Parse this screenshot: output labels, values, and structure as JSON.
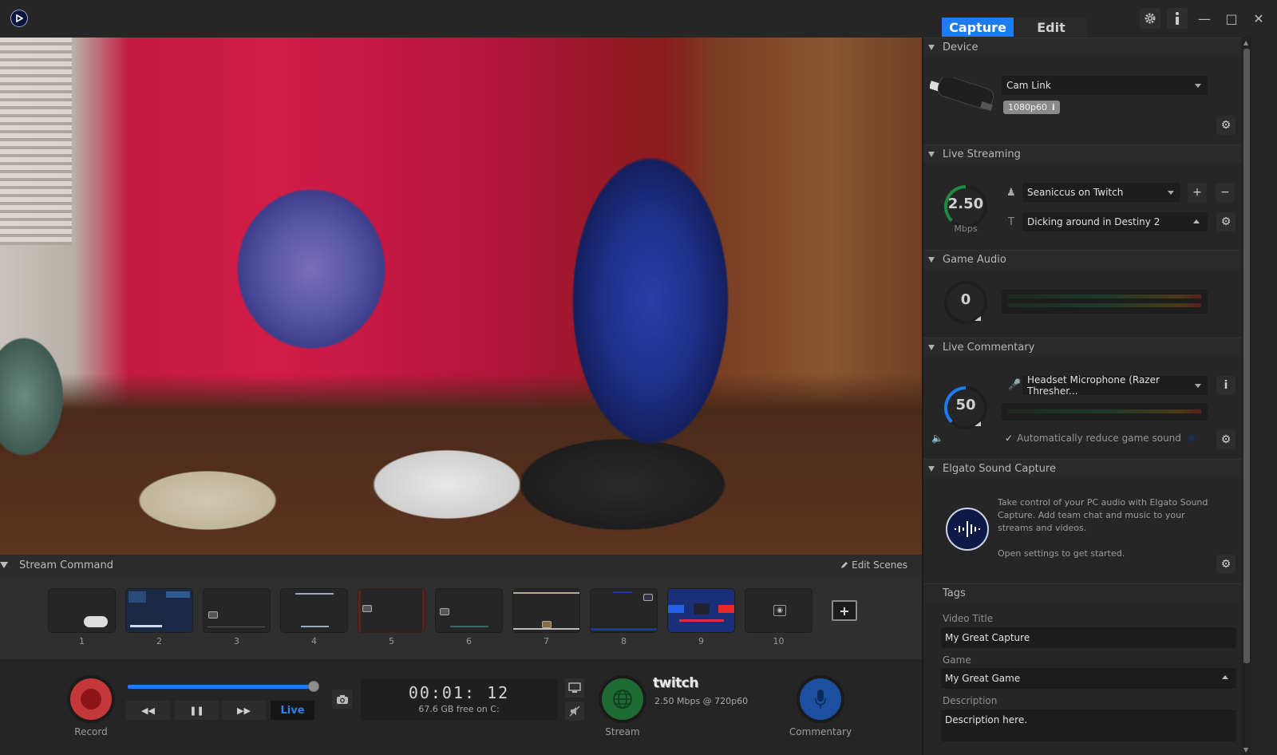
{
  "titlebar": {
    "tabs": [
      {
        "label": "Capture",
        "active": true
      },
      {
        "label": "Edit",
        "active": false
      }
    ],
    "icons": [
      "gear-icon",
      "info-icon",
      "minimize-icon",
      "maximize-icon",
      "close-icon"
    ]
  },
  "stream_command": {
    "title": "Stream Command",
    "edit_scenes_label": "Edit Scenes",
    "scenes": [
      {
        "number": "1"
      },
      {
        "number": "2"
      },
      {
        "number": "3"
      },
      {
        "number": "4"
      },
      {
        "number": "5"
      },
      {
        "number": "6"
      },
      {
        "number": "7"
      },
      {
        "number": "8"
      },
      {
        "number": "9"
      },
      {
        "number": "10"
      }
    ]
  },
  "bottom_bar": {
    "record_label": "Record",
    "playback_progress_percent": 100,
    "live_label": "Live",
    "timer": "00:01: 12",
    "disk_free": "67.6 GB free on C:",
    "stream_label": "Stream",
    "platform": "twitch",
    "stream_info": "2.50 Mbps @ 720p60",
    "commentary_label": "Commentary"
  },
  "panel": {
    "device": {
      "title": "Device",
      "selected": "Cam Link",
      "resolution_badge": "1080p60"
    },
    "live_streaming": {
      "title": "Live Streaming",
      "bitrate_value": "2.50",
      "bitrate_unit": "Mbps",
      "bitrate_fraction": 0.5,
      "account": "Seaniccus on Twitch",
      "stream_title": "Dicking around in Destiny 2"
    },
    "game_audio": {
      "title": "Game Audio",
      "volume": "0"
    },
    "live_commentary": {
      "title": "Live Commentary",
      "volume": "50",
      "volume_fraction": 0.5,
      "microphone": "Headset Microphone (Razer Thresher...",
      "auto_reduce_label": "Automatically reduce game sound",
      "auto_reduce_checked": true
    },
    "sound_capture": {
      "title": "Elgato Sound Capture",
      "description": "Take control of your PC audio with Elgato Sound Capture. Add team chat and music to your streams and videos.",
      "hint": "Open settings to get started."
    },
    "tags": {
      "title": "Tags",
      "video_title_label": "Video Title",
      "video_title": "My Great Capture",
      "game_label": "Game",
      "game": "My Great Game",
      "description_label": "Description",
      "description": "Description here."
    }
  },
  "colors": {
    "accent": "#1e7bf0",
    "record": "#c4383a",
    "stream": "#1f6b34",
    "commentary": "#1d4fa0"
  }
}
